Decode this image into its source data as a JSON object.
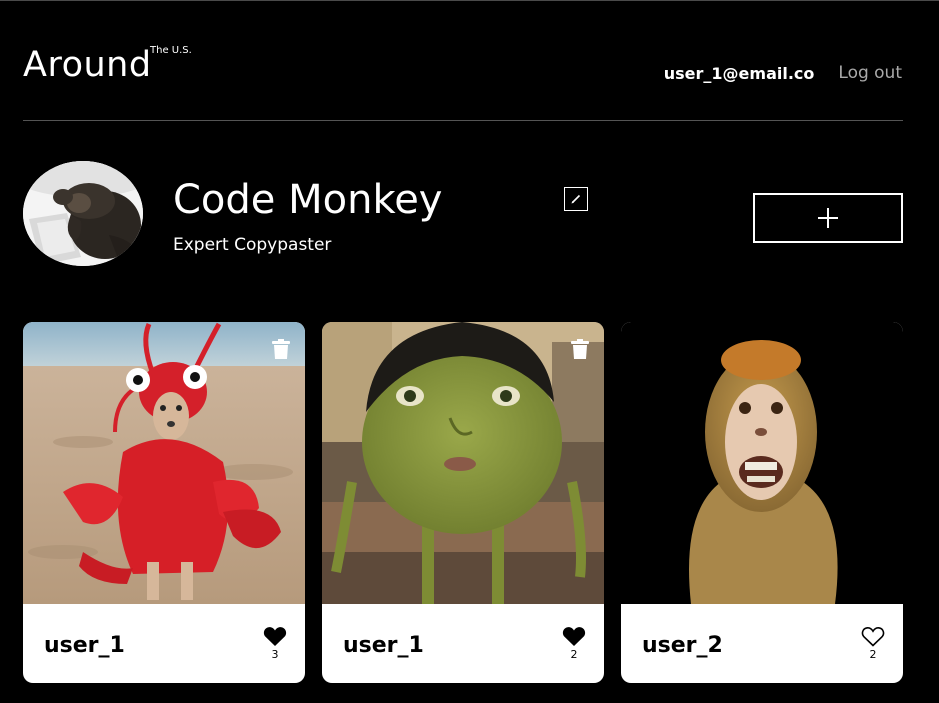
{
  "header": {
    "logo": "Around",
    "logo_sup": "The U.S.",
    "user_email": "user_1@email.co",
    "logout_label": "Log out"
  },
  "profile": {
    "name": "Code Monkey",
    "about": "Expert Copypaster"
  },
  "cards": [
    {
      "user": "user_1",
      "likes": "3",
      "liked": true,
      "deletable": true
    },
    {
      "user": "user_1",
      "likes": "2",
      "liked": true,
      "deletable": true
    },
    {
      "user": "user_2",
      "likes": "2",
      "liked": false,
      "deletable": false
    }
  ],
  "colors": {
    "background": "#000000",
    "card": "#ffffff",
    "muted_text": "#a9a9a9",
    "divider": "#545454"
  }
}
